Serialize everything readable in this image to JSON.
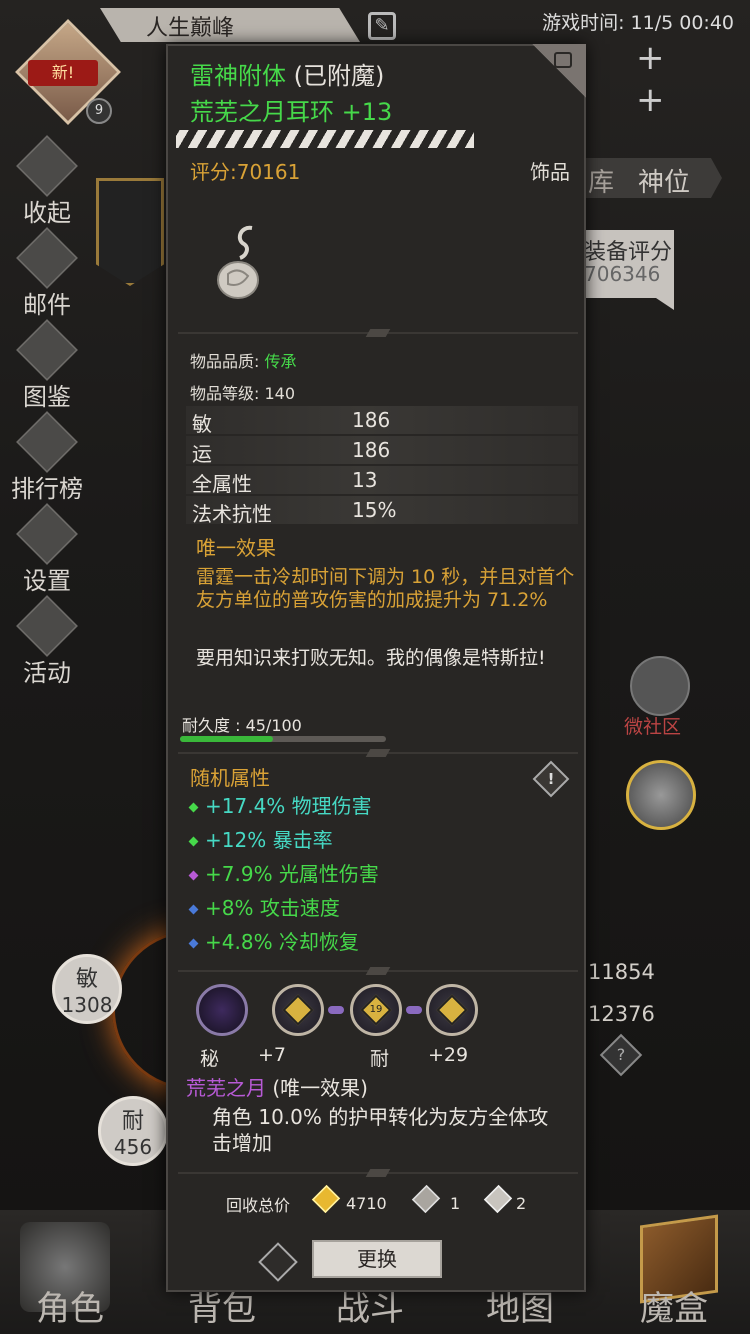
{
  "header": {
    "title": "人生巅峰",
    "time_label": "游戏时间:",
    "time_value": "11/5 00:40",
    "new_tag": "新!",
    "level": "9"
  },
  "sidebar": {
    "items": [
      {
        "label": "收起",
        "icon": "collapse-icon"
      },
      {
        "label": "邮件",
        "icon": "mail-icon"
      },
      {
        "label": "图鉴",
        "icon": "book-icon"
      },
      {
        "label": "排行榜",
        "icon": "ranking-icon"
      },
      {
        "label": "设置",
        "icon": "gear-icon"
      },
      {
        "label": "活动",
        "icon": "event-icon"
      }
    ]
  },
  "right_panel": {
    "tab_ku": "库",
    "tab_shenwei": "神位",
    "equip_score_label": "装备评分",
    "equip_score_value": "706346",
    "community_label": "微社区",
    "num1": "11854",
    "num2": "12376"
  },
  "stats_left": {
    "agi_label": "敏",
    "agi_value": "1308",
    "end_label": "耐",
    "end_value": "456"
  },
  "bottom_nav": [
    "角色",
    "背包",
    "战斗",
    "地图",
    "魔盒"
  ],
  "tooltip": {
    "name": "雷神附体",
    "name_suffix": "(已附魔)",
    "item_name": "荒芜之月耳环 +13",
    "score": "评分:70161",
    "slot_type": "饰品",
    "quality_label": "物品品质:",
    "quality_value": "传承",
    "level_label": "物品等级:",
    "level_value": "140",
    "attributes": [
      {
        "name": "敏",
        "value": "186"
      },
      {
        "name": "运",
        "value": "186"
      },
      {
        "name": "全属性",
        "value": "13"
      },
      {
        "name": "法术抗性",
        "value": "15%"
      }
    ],
    "unique_title": "唯一效果",
    "unique_desc": "雷霆一击冷却时间下调为 10 秒，并且对首个友方单位的普攻伤害的加成提升为 71.2%",
    "flavor": "要用知识来打败无知。我的偶像是特斯拉!",
    "durability_label": "耐久度 : 45/100",
    "durability_fraction": 0.45,
    "random_title": "随机属性",
    "random_attrs": [
      {
        "text": "+17.4% 物理伤害",
        "color": "#46d9c4",
        "dot": "#46d94a"
      },
      {
        "text": "+12% 暴击率",
        "color": "#46d9c4",
        "dot": "#46d94a"
      },
      {
        "text": "+7.9% 光属性伤害",
        "color": "#46d94a",
        "dot": "#b85ad6"
      },
      {
        "text": "+8% 攻击速度",
        "color": "#46d94a",
        "dot": "#4a7ad9"
      },
      {
        "text": "+4.8% 冷却恢复",
        "color": "#46d94a",
        "dot": "#4a7ad9"
      }
    ],
    "socket_labels": [
      "秘",
      "+7",
      "耐",
      "+29"
    ],
    "socket_gems": [
      "",
      "",
      "19",
      ""
    ],
    "set_title": "荒芜之月",
    "set_suffix": "(唯一效果)",
    "set_desc": "角色 10.0% 的护甲转化为友方全体攻击增加",
    "recycle_label": "回收总价",
    "recycle_gold": "4710",
    "recycle_mat1": "1",
    "recycle_mat2": "2",
    "swap_button": "更换"
  }
}
